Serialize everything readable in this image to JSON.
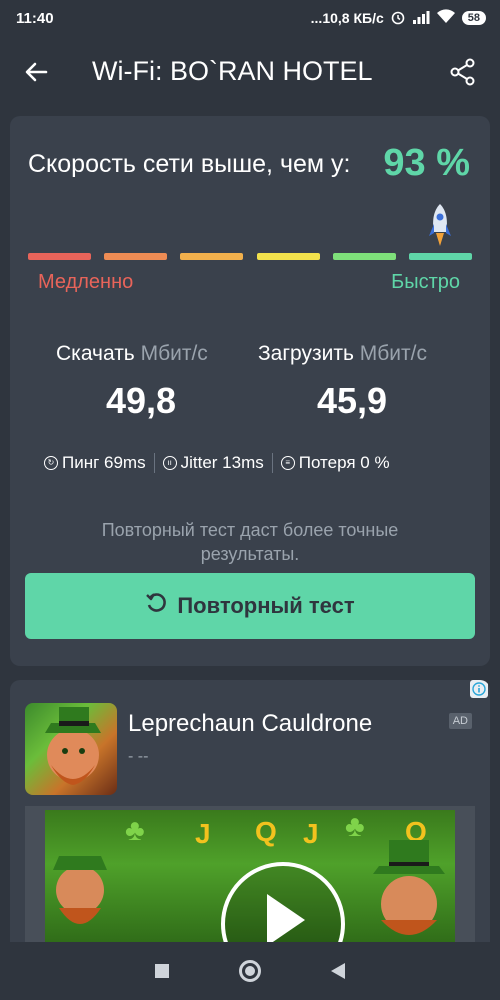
{
  "status_bar": {
    "time": "11:40",
    "network_speed": "...10,8 КБ/с",
    "battery": "58"
  },
  "app_bar": {
    "title": "Wi-Fi: BO`RAN HOTEL",
    "back_icon": "arrow-back-icon",
    "share_icon": "share-icon"
  },
  "speed_card": {
    "headline": "Скорость сети выше, чем у:",
    "percent": "93 %",
    "bar_colors": [
      "#e8645a",
      "#ee8c54",
      "#f2b04c",
      "#f2e14c",
      "#7ee07a",
      "#5fd6a8"
    ],
    "slow_label": "Медленно",
    "fast_label": "Быстро",
    "download": {
      "label": "Скачать",
      "unit": "Мбит/с",
      "value": "49,8"
    },
    "upload": {
      "label": "Загрузить",
      "unit": "Мбит/с",
      "value": "45,9"
    },
    "ping": "Пинг 69ms",
    "jitter": "Jitter 13ms",
    "loss": "Потеря 0 %",
    "hint": "Повторный тест даст более точные результаты.",
    "retest_button": "Повторный тест"
  },
  "ad": {
    "title": "Leprechaun Cauldrone",
    "subtitle": "- --",
    "badge": "AD"
  },
  "colors": {
    "background": "#2f353e",
    "card": "#3a414c",
    "accent": "#5fd6a8",
    "slow": "#e8645a"
  }
}
